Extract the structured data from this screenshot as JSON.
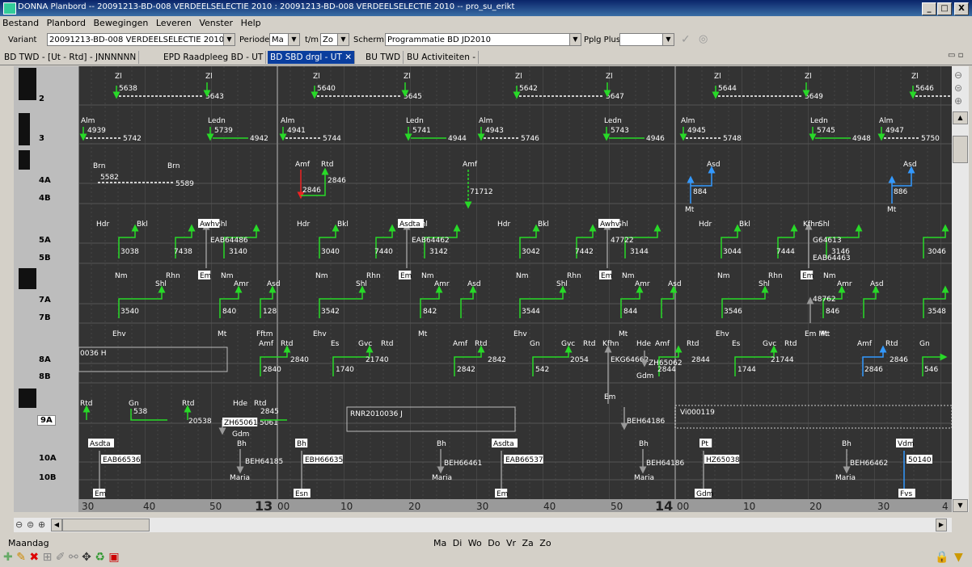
{
  "window": {
    "title": "DONNA Planbord -- 20091213-BD-008 VERDEELSELECTIE 2010 : 20091213-BD-008 VERDEELSELECTIE 2010 -- pro_su_erikt",
    "min_label": "_",
    "max_label": "□",
    "close_label": "X"
  },
  "menu": [
    "Bestand",
    "Planbord",
    "Bewegingen",
    "Leveren",
    "Venster",
    "Help"
  ],
  "toolbar": {
    "variant_label": "Variant",
    "variant_value": "20091213-BD-008 VERDEELSELECTIE 2010",
    "periode_label": "Periode",
    "periode_from": "Ma",
    "tm_label": "t/m",
    "periode_to": "Zo",
    "scherm_label": "Scherm",
    "scherm_value": "Programmatie BD JD2010",
    "pplg_label": "Pplg Plus",
    "pplg_value": ""
  },
  "tabs": [
    {
      "label": "BD TWD - [Ut - Rtd] - JNNNNNN",
      "active": false
    },
    {
      "label": "EPD Raadpleeg BD - UT",
      "active": false
    },
    {
      "label": "BD SBD drgl - UT ✕",
      "active": true
    },
    {
      "label": "BU TWD",
      "active": false
    },
    {
      "label": "BU Activiteiten -",
      "active": false
    }
  ],
  "rows": [
    "2",
    "3",
    "4A",
    "4B",
    "5A",
    "5B",
    "7A",
    "7B",
    "8A",
    "8B",
    "9A",
    "10A",
    "10B"
  ],
  "time_axis": {
    "ticks": [
      "30",
      "40",
      "50",
      "00",
      "10",
      "20",
      "30",
      "40",
      "50",
      "00",
      "10",
      "20",
      "30",
      "4"
    ],
    "hours": [
      "13",
      "14"
    ]
  },
  "chart_texts": {
    "zl": "Zl",
    "trains_row2": [
      "5638",
      "5643",
      "5640",
      "5645",
      "5642",
      "5647",
      "5644",
      "5649",
      "5646"
    ],
    "row3_stations": [
      "Alm",
      "Ledn"
    ],
    "trains_row3": [
      "4939",
      "5742",
      "5739",
      "4942",
      "4941",
      "5744",
      "5741",
      "4944",
      "4943",
      "5746",
      "5743",
      "4946",
      "4945",
      "5748",
      "5745",
      "4948",
      "4947",
      "5750"
    ],
    "row4": [
      "Brn",
      "5582",
      "5589",
      "Amf",
      "Rtd",
      "2846",
      "2846",
      "71712",
      "Asd",
      "884",
      "Mt",
      "886"
    ],
    "row5": [
      "Hdr",
      "Bkl",
      "Awhv",
      "Shl",
      "3038",
      "7438",
      "3140",
      "EAB64486",
      "Nm",
      "Rhn",
      "Em",
      "3040",
      "7440",
      "3142",
      "Asdta",
      "EAB64462",
      "3042",
      "7442",
      "3144",
      "47722",
      "Kfhn",
      "G64613",
      "3146",
      "EAB64463",
      "3044",
      "7444",
      "3046"
    ],
    "row7": [
      "Shl",
      "Amr",
      "Asd",
      "3540",
      "840",
      "128",
      "Ehv",
      "Mt",
      "Fftm",
      "3542",
      "842",
      "3544",
      "844",
      "3546",
      "48762",
      "846",
      "Em Mt",
      "3548"
    ],
    "row8": [
      "Amf",
      "Rtd",
      "2840",
      "Es",
      "Gvc",
      "Gn",
      "1740",
      "21740",
      "2842",
      "542",
      "2054",
      "EKG64662",
      "Hde",
      "Gdm",
      "ZH65062",
      "2844",
      "1744",
      "21744",
      "2846",
      "546",
      "Em",
      "0036 H"
    ],
    "row9": [
      "Rtd",
      "Gn",
      "538",
      "20538",
      "Hde",
      "ZH65061",
      "5061",
      "2845",
      "RNR2010036 J",
      "BEH64186",
      "Vi000119"
    ],
    "row10": [
      "Asdta",
      "EAB66536",
      "Em",
      "Bh",
      "BEH64185",
      "Maria",
      "EBH66635",
      "Esn",
      "BEH66461",
      "EAB66537",
      "BEH64186",
      "Pt",
      "HZ65038",
      "Gdm",
      "BEH66462",
      "Vdm",
      "50140",
      "Fvs"
    ]
  },
  "status": {
    "day": "Maandag",
    "days": [
      "Ma",
      "Di",
      "Wo",
      "Do",
      "Vr",
      "Za",
      "Zo"
    ]
  }
}
